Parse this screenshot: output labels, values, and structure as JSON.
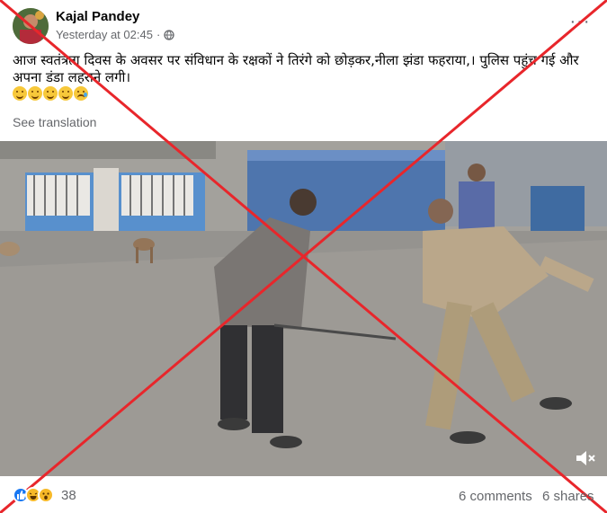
{
  "post": {
    "author": "Kajal Pandey",
    "timestamp": "Yesterday at 02:45",
    "separator": "·",
    "privacy_icon": "globe-icon",
    "more_label": "···",
    "text": "आज स्वतंत्रता दिवस के अवसर पर संविधान के रक्षकों ने तिरंगे को छोड़कर,नीला झंडा फहराया,। पुलिस पहुंच गई और अपना डंडा लहराने लगी।",
    "emojis": [
      "smiling-face",
      "smiling-face",
      "smiling-face",
      "smiling-face",
      "sad-tear-face"
    ],
    "see_translation": "See translation"
  },
  "video": {
    "audio_icon": "speaker-muted-icon"
  },
  "overlay": {
    "mark": "red-x-cross",
    "color": "#e8262b"
  },
  "footer": {
    "reaction_icons": [
      "like-icon",
      "haha-icon",
      "wow-icon"
    ],
    "reaction_count": "38",
    "comments": "6 comments",
    "shares": "6 shares"
  },
  "colors": {
    "secondary_text": "#65676b",
    "primary_text": "#050505",
    "like_blue": "#1877f2"
  }
}
